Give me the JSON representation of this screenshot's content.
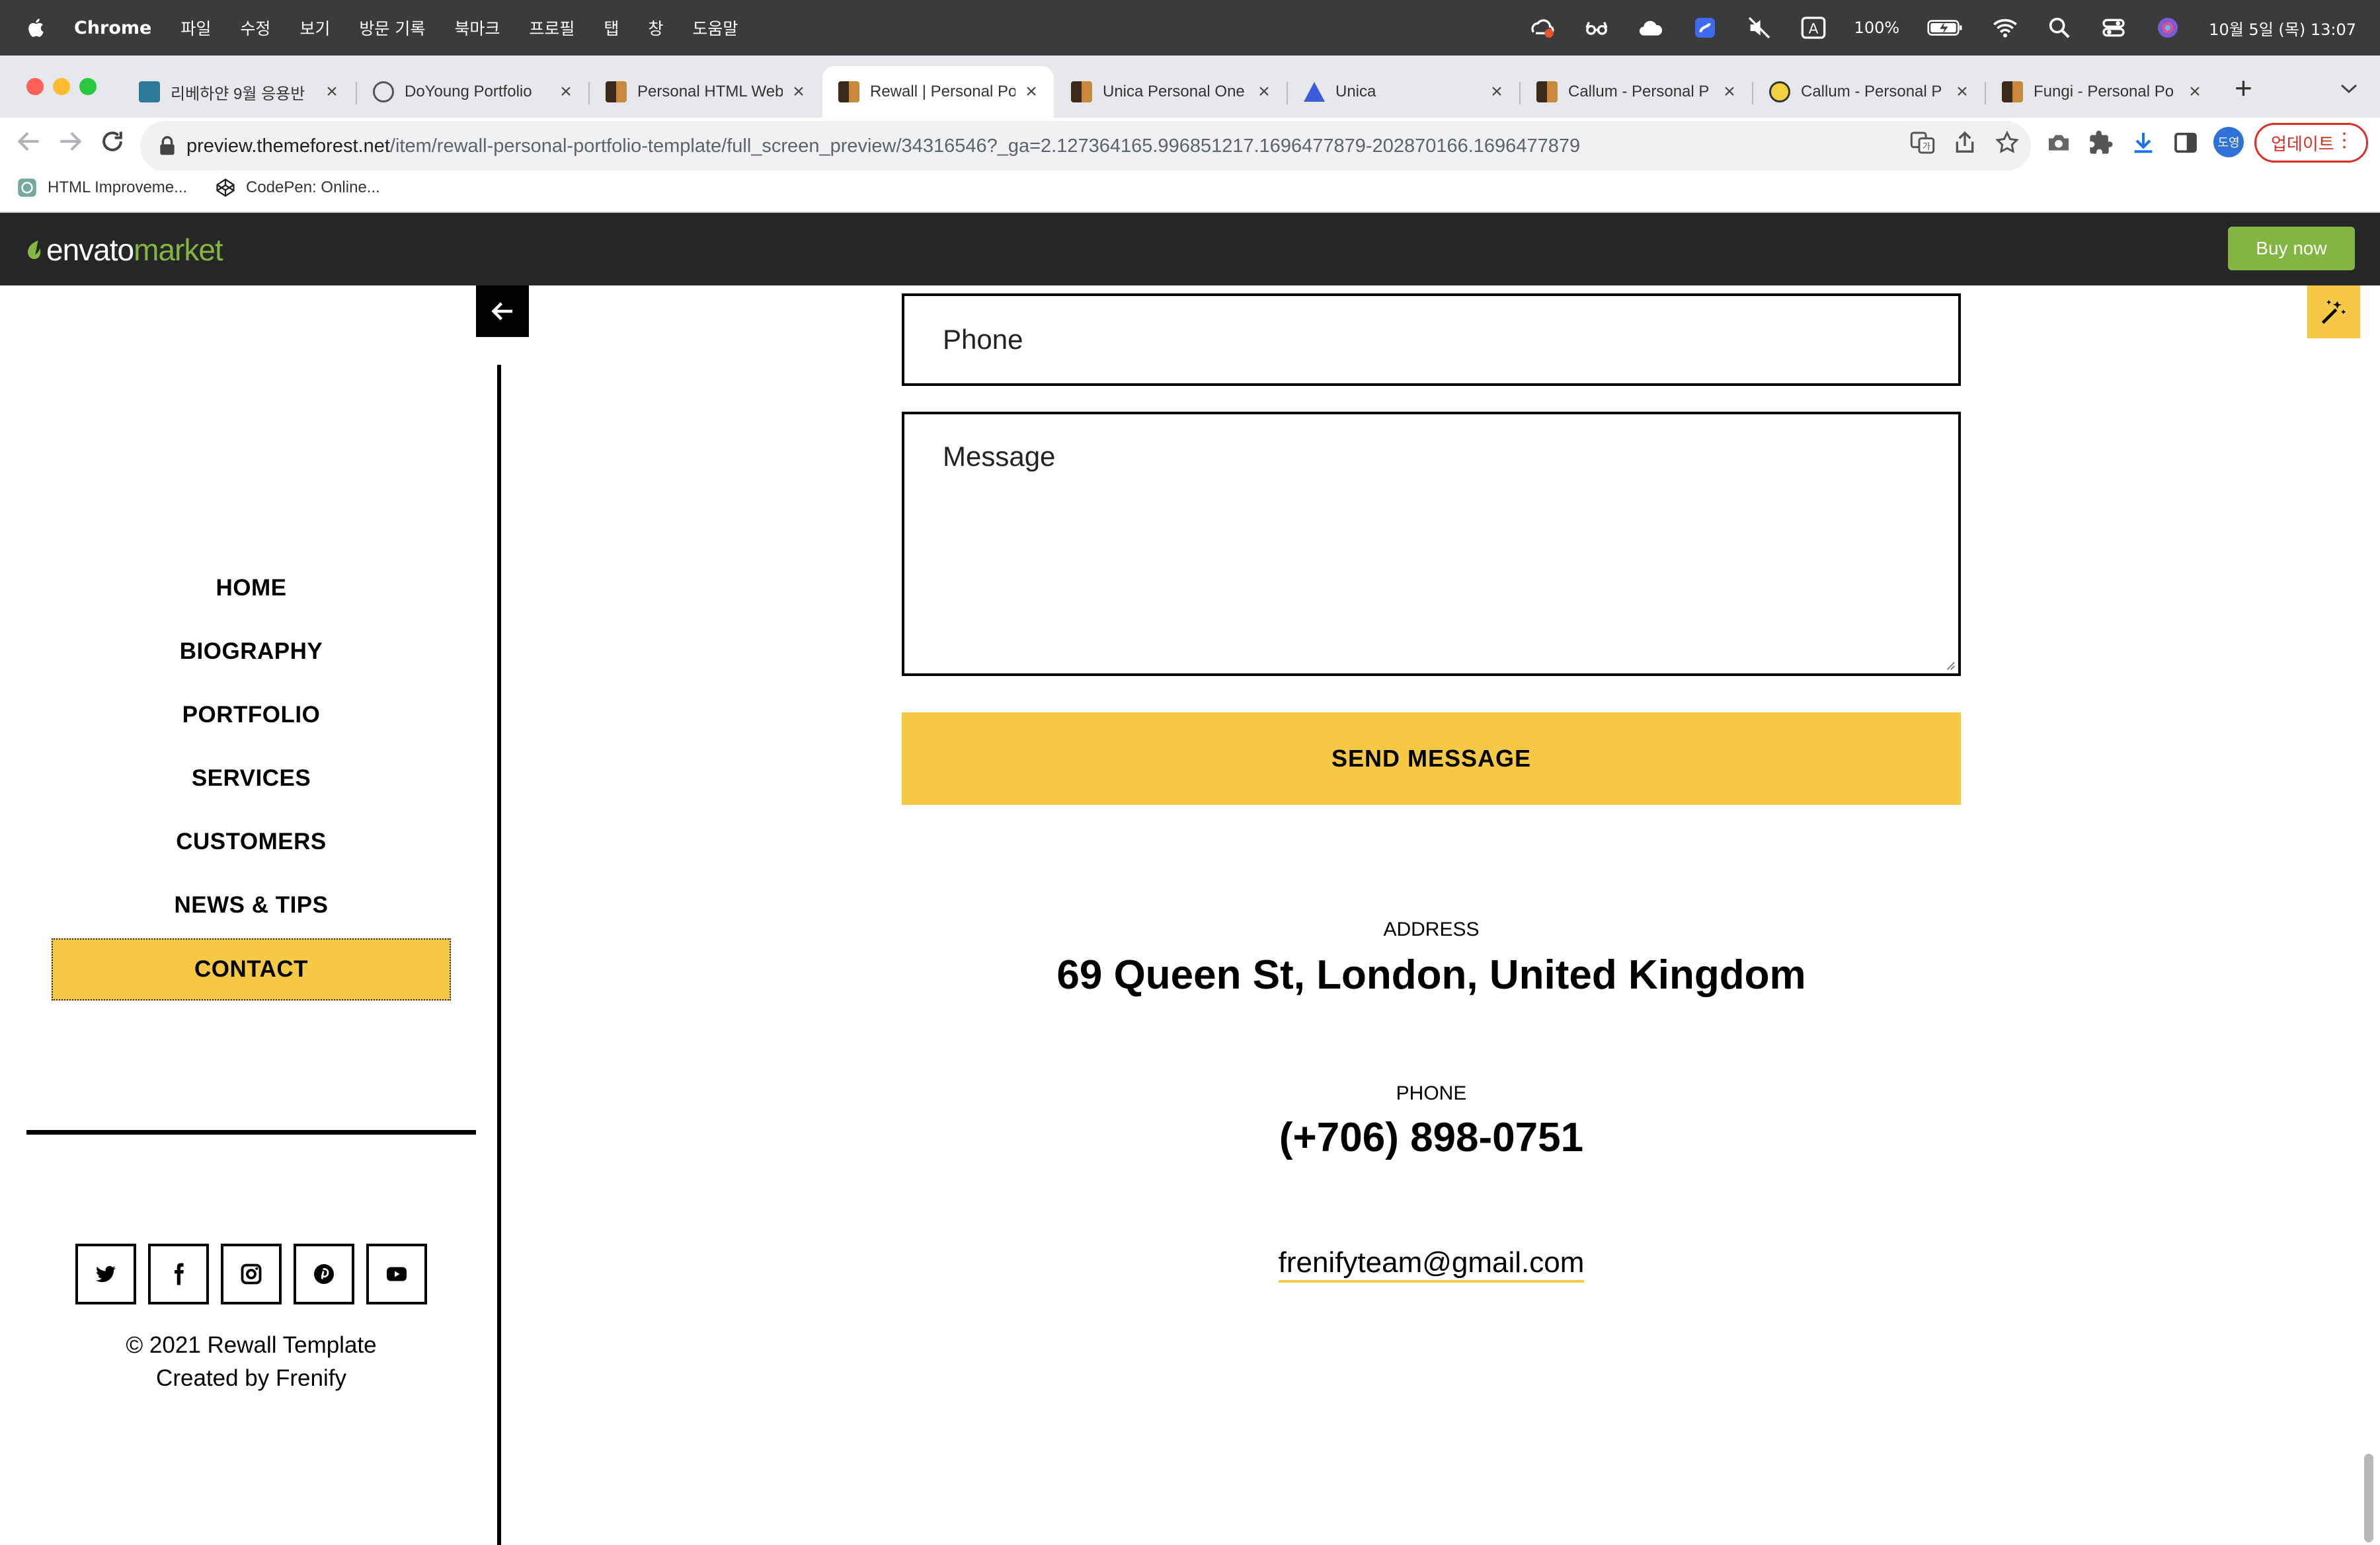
{
  "menubar": {
    "app": "Chrome",
    "menus": [
      "파일",
      "수정",
      "보기",
      "방문 기록",
      "북마크",
      "프로필",
      "탭",
      "창",
      "도움말"
    ],
    "battery": "100%",
    "input_indicator": "A",
    "datetime": "10월 5일 (목) 13:07"
  },
  "tabs": [
    {
      "title": "리베하얀 9월 응용반",
      "active": false
    },
    {
      "title": "DoYoung Portfolio",
      "active": false
    },
    {
      "title": "Personal HTML Web",
      "active": false
    },
    {
      "title": "Rewall | Personal Po",
      "active": true
    },
    {
      "title": "Unica Personal One",
      "active": false
    },
    {
      "title": "Unica",
      "active": false
    },
    {
      "title": "Callum - Personal P",
      "active": false
    },
    {
      "title": "Callum - Personal P",
      "active": false
    },
    {
      "title": "Fungi - Personal Po",
      "active": false
    }
  ],
  "address": {
    "domain": "preview.themeforest.net",
    "path": "/item/rewall-personal-portfolio-template/full_screen_preview/34316546?_ga=2.127364165.996851217.1696477879-202870166.1696477879"
  },
  "toolbar": {
    "profile_label": "도영",
    "update_label": "업데이트"
  },
  "bookmarks": [
    {
      "label": "HTML Improveme..."
    },
    {
      "label": "CodePen: Online..."
    }
  ],
  "envato": {
    "logo_main": "envato",
    "logo_sub": "market",
    "buy_label": "Buy now"
  },
  "sidebar": {
    "menu": [
      "HOME",
      "BIOGRAPHY",
      "PORTFOLIO",
      "SERVICES",
      "CUSTOMERS",
      "NEWS & TIPS",
      "CONTACT"
    ],
    "active_item": "CONTACT",
    "socials": [
      "twitter-icon",
      "facebook-icon",
      "instagram-icon",
      "pinterest-icon",
      "youtube-icon"
    ],
    "copyright": "© 2021 Rewall Template",
    "credit": "Created by Frenify"
  },
  "form": {
    "phone_placeholder": "Phone",
    "message_placeholder": "Message",
    "send_label": "SEND MESSAGE"
  },
  "contact": {
    "address_label": "ADDRESS",
    "address_value": "69 Queen St, London, United Kingdom",
    "phone_label": "PHONE",
    "phone_value": "(+706) 898-0751",
    "email": "frenifyteam@gmail.com"
  },
  "colors": {
    "accent": "#f6c945",
    "envato_green": "#82b541",
    "envato_bar": "#262626",
    "update_red": "#d93025"
  }
}
